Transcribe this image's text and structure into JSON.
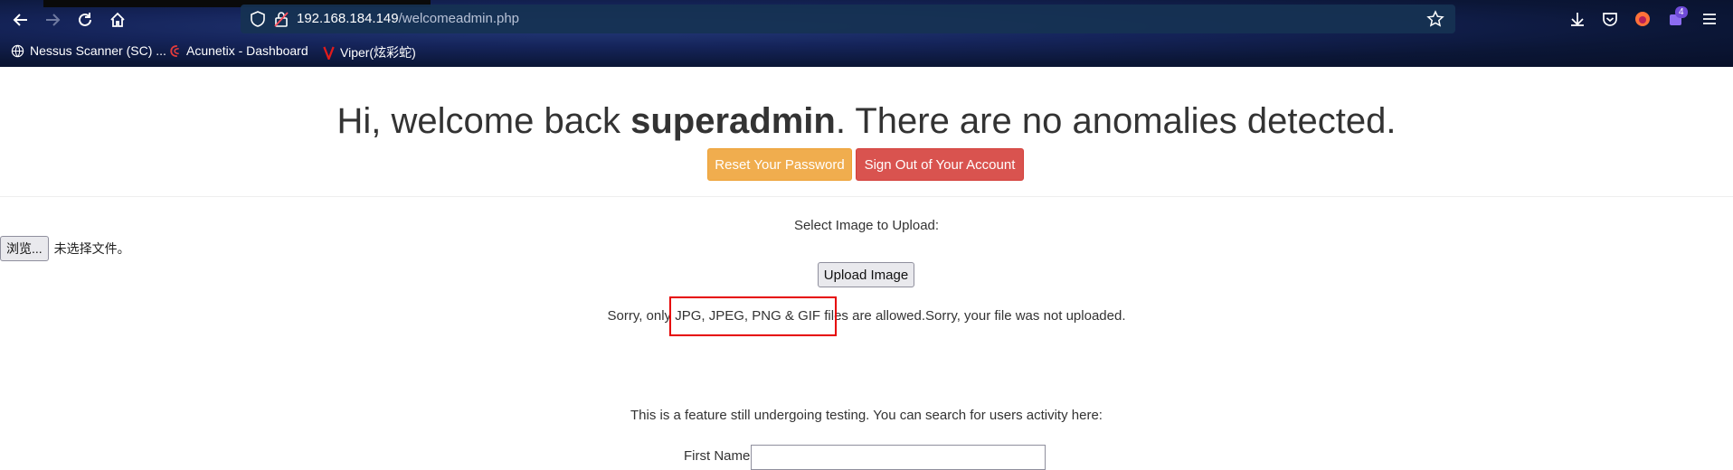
{
  "browser": {
    "url_host": "192.168.184.149",
    "url_path": "/welcomeadmin.php",
    "extension_badge": "4",
    "bookmarks": [
      {
        "label": "Nessus Scanner (SC) ...",
        "icon": "globe-icon"
      },
      {
        "label": "Acunetix - Dashboard",
        "icon": "acunetix-icon"
      },
      {
        "label": "Viper(炫彩蛇)",
        "icon": "viper-icon"
      }
    ]
  },
  "page": {
    "welcome_prefix": "Hi, welcome back ",
    "username": "superadmin",
    "welcome_suffix": ". There are no anomalies detected.",
    "reset_button": "Reset Your Password",
    "signout_button": "Sign Out of Your Account",
    "select_label": "Select Image to Upload:",
    "browse_button": "浏览...",
    "no_file_text": "未选择文件。",
    "upload_button": "Upload Image",
    "upload_message": "Sorry, only JPG, JPEG, PNG & GIF files are allowed.Sorry, your file was not uploaded.",
    "testing_text": "This is a feature still undergoing testing. You can search for users activity here:",
    "first_name_label": "First Name:",
    "first_name_value": ""
  },
  "colors": {
    "warning": "#f0ad4e",
    "danger": "#d9534f",
    "annotation": "#e60000"
  }
}
